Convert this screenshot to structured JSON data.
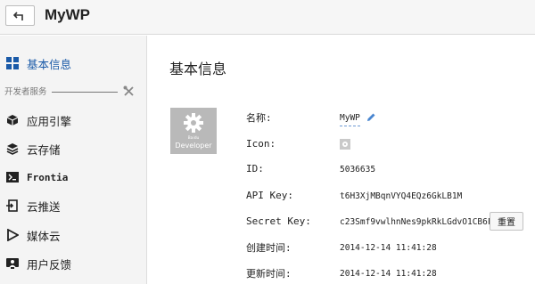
{
  "header": {
    "app_name": "MyWP"
  },
  "sidebar": {
    "items": [
      {
        "label": "基本信息",
        "icon": "grid-icon"
      },
      {
        "label": "应用引擎",
        "icon": "cube-icon"
      },
      {
        "label": "云存储",
        "icon": "layers-icon"
      },
      {
        "label": "Frontia",
        "icon": "terminal-icon"
      },
      {
        "label": "云推送",
        "icon": "push-icon"
      },
      {
        "label": "媒体云",
        "icon": "play-icon"
      },
      {
        "label": "用户反馈",
        "icon": "feedback-icon"
      }
    ],
    "section_label": "开发者服务",
    "colors": {
      "active": "#1a5aa8"
    }
  },
  "main": {
    "title": "基本信息",
    "app_icon": {
      "caption_small": "Baidu",
      "caption": "Developer"
    },
    "fields": [
      {
        "label": "名称:",
        "value": "MyWP"
      },
      {
        "label": "Icon:",
        "value": ""
      },
      {
        "label": "ID:",
        "value": "5036635"
      },
      {
        "label": "API Key:",
        "value": "t6H3XjMBqnVYQ4EQz6GkLB1M"
      },
      {
        "label": "Secret Key:",
        "value": "c23Smf9vwlhnNes9pkRkLGdvO1CB6FOU"
      },
      {
        "label": "创建时间:",
        "value": "2014-12-14 11:41:28"
      },
      {
        "label": "更新时间:",
        "value": "2014-12-14 11:41:28"
      }
    ],
    "reset_label": "重置"
  }
}
